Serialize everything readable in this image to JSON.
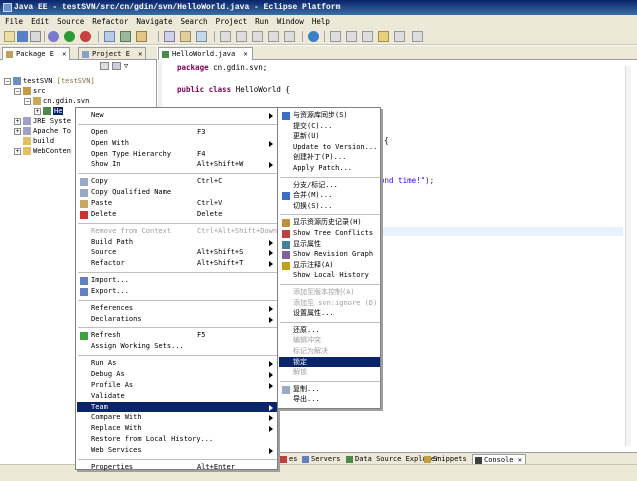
{
  "window": {
    "title": "Java EE - testSVN/src/cn/gdin/svn/HelloWorld.java - Eclipse Platform"
  },
  "menubar": [
    "File",
    "Edit",
    "Source",
    "Refactor",
    "Navigate",
    "Search",
    "Project",
    "Run",
    "Window",
    "Help"
  ],
  "views": {
    "package_tab": "Package E",
    "project_tab": "Project E"
  },
  "editor_tab": "HelloWorld.java",
  "tree": [
    {
      "label": "testSVN",
      "suffix": "[testSVN]"
    },
    {
      "label": "src"
    },
    {
      "label": "cn.gdin.svn"
    },
    {
      "label": "He"
    },
    {
      "label": "JRE Syste"
    },
    {
      "label": "Apache To"
    },
    {
      "label": "build"
    },
    {
      "label": "WebConten"
    }
  ],
  "code": {
    "line1_kw": "package",
    "line1_rest": " cn.gdin.svn;",
    "line2_kw1": "public",
    "line2_kw2": "class",
    "line2_rest": " HelloWorld {",
    "line3": "/**",
    "line4": "{",
    "line5_str": "ond time!\");"
  },
  "context_menu": [
    {
      "label": "New",
      "submenu": true
    },
    {
      "sep": true
    },
    {
      "label": "Open",
      "accel": "F3"
    },
    {
      "label": "Open With",
      "submenu": true
    },
    {
      "label": "Open Type Hierarchy",
      "accel": "F4"
    },
    {
      "label": "Show In",
      "accel": "Alt+Shift+W",
      "submenu": true
    },
    {
      "sep": true
    },
    {
      "label": "Copy",
      "accel": "Ctrl+C",
      "icon": "copy-icon"
    },
    {
      "label": "Copy Qualified Name",
      "icon": "copy-icon"
    },
    {
      "label": "Paste",
      "accel": "Ctrl+V",
      "icon": "paste-icon"
    },
    {
      "label": "Delete",
      "accel": "Delete",
      "icon": "delete-icon"
    },
    {
      "sep": true
    },
    {
      "label": "Remove from Context",
      "accel": "Ctrl+Alt+Shift+Down",
      "disabled": true
    },
    {
      "label": "Build Path",
      "submenu": true
    },
    {
      "label": "Source",
      "accel": "Alt+Shift+S",
      "submenu": true
    },
    {
      "label": "Refactor",
      "accel": "Alt+Shift+T",
      "submenu": true
    },
    {
      "sep": true
    },
    {
      "label": "Import...",
      "icon": "import-icon"
    },
    {
      "label": "Export...",
      "icon": "export-icon"
    },
    {
      "sep": true
    },
    {
      "label": "References",
      "submenu": true
    },
    {
      "label": "Declarations",
      "submenu": true
    },
    {
      "sep": true
    },
    {
      "label": "Refresh",
      "accel": "F5",
      "icon": "refresh-icon"
    },
    {
      "label": "Assign Working Sets..."
    },
    {
      "sep": true
    },
    {
      "label": "Run As",
      "submenu": true
    },
    {
      "label": "Debug As",
      "submenu": true
    },
    {
      "label": "Profile As",
      "submenu": true
    },
    {
      "label": "Validate"
    },
    {
      "label": "Team",
      "submenu": true,
      "selected": true
    },
    {
      "label": "Compare With",
      "submenu": true
    },
    {
      "label": "Replace With",
      "submenu": true
    },
    {
      "label": "Restore from Local History..."
    },
    {
      "label": "Web Services",
      "submenu": true
    },
    {
      "sep": true
    },
    {
      "label": "Properties",
      "accel": "Alt+Enter"
    }
  ],
  "team_menu": [
    {
      "label": "与资源库同步(S)",
      "icon": "sync-icon"
    },
    {
      "label": "提交(C)..."
    },
    {
      "label": "更新(U)"
    },
    {
      "label": "Update to Version..."
    },
    {
      "label": "创建补丁(P)..."
    },
    {
      "label": "Apply Patch..."
    },
    {
      "sep": true
    },
    {
      "label": "分支/标记..."
    },
    {
      "label": "合并(M)...",
      "icon": "merge-icon"
    },
    {
      "label": "切换(S)..."
    },
    {
      "sep": true
    },
    {
      "label": "显示资源历史记录(H)",
      "icon": "history-icon"
    },
    {
      "label": "Show Tree Conflicts",
      "icon": "conflict-icon"
    },
    {
      "label": "显示属性",
      "icon": "properties-icon"
    },
    {
      "label": "Show Revision Graph",
      "icon": "graph-icon"
    },
    {
      "label": "显示注释(A)",
      "icon": "annotate-icon"
    },
    {
      "label": "Show Local History"
    },
    {
      "sep": true
    },
    {
      "label": "添加至版本控制(A)",
      "disabled": true
    },
    {
      "label": "添加至 svn:ignore (D)",
      "disabled": true
    },
    {
      "label": "设置属性..."
    },
    {
      "sep": true
    },
    {
      "label": "还原..."
    },
    {
      "label": "编辑冲突",
      "disabled": true
    },
    {
      "label": "标记为解决",
      "disabled": true
    },
    {
      "label": "锁定",
      "selected": true
    },
    {
      "label": "解锁",
      "disabled": true
    },
    {
      "sep": true
    },
    {
      "label": "复制...",
      "icon": "copy-icon"
    },
    {
      "label": "导出..."
    }
  ],
  "bottom_tabs": [
    {
      "label": "es",
      "icon": "problems-icon"
    },
    {
      "label": "Servers",
      "icon": "servers-icon"
    },
    {
      "label": "Data Source Explorer",
      "icon": "datasource-icon"
    },
    {
      "label": "Snippets",
      "icon": "snippets-icon"
    },
    {
      "label": "Console",
      "icon": "console-icon",
      "active": true
    }
  ],
  "svn_label": "SVN",
  "colors": {
    "menu_select": "#0a246a",
    "title_bar": "#0a246a",
    "chrome": "#ece9d8"
  }
}
